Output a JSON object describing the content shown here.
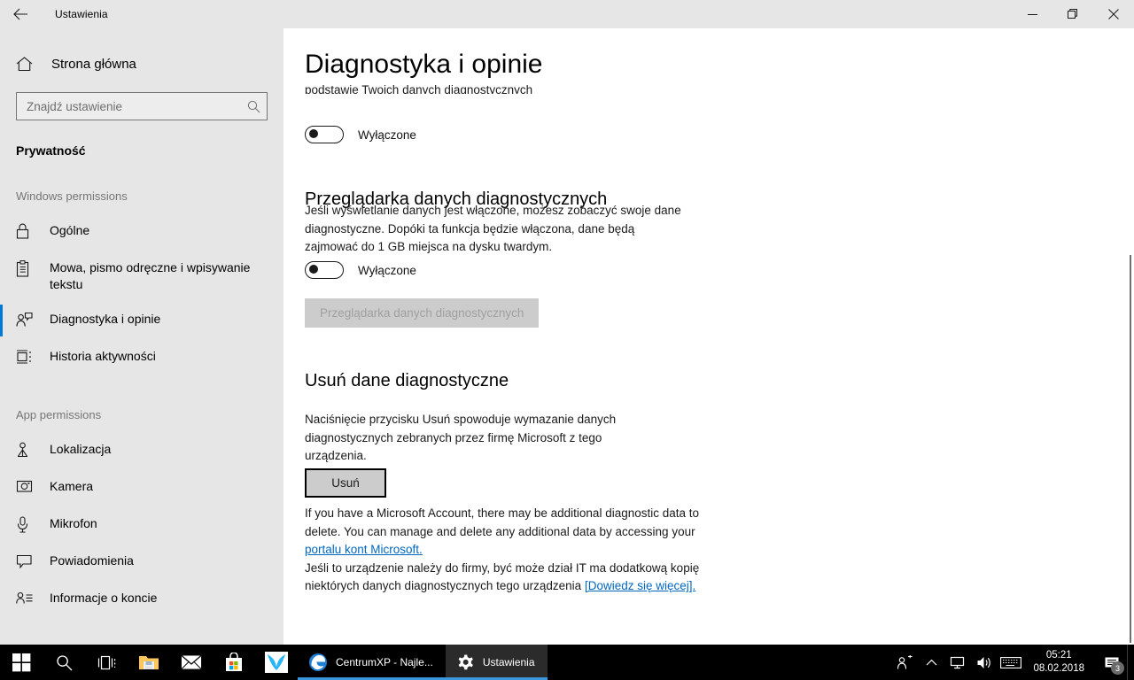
{
  "window": {
    "titlebar_title": "Ustawienia",
    "back_icon": "back-arrow-icon",
    "minimize_label": "minimize-icon",
    "restore_label": "restore-icon",
    "close_label": "close-icon"
  },
  "sidebar": {
    "home_label": "Strona główna",
    "home_icon": "home-icon",
    "search": {
      "placeholder": "Znajdź ustawienie",
      "value": "",
      "icon": "search-icon"
    },
    "category_title": "Prywatność",
    "groups": [
      {
        "header": "Windows permissions",
        "items": [
          {
            "label": "Ogólne",
            "icon": "lock-icon",
            "selected": false
          },
          {
            "label": "Mowa, pismo odręczne i wpisywanie tekstu",
            "icon": "clipboard-icon",
            "selected": false
          },
          {
            "label": "Diagnostyka i opinie",
            "icon": "feedback-person-icon",
            "selected": true
          },
          {
            "label": "Historia aktywności",
            "icon": "activity-history-icon",
            "selected": false
          }
        ]
      },
      {
        "header": "App permissions",
        "items": [
          {
            "label": "Lokalizacja",
            "icon": "location-pin-icon",
            "selected": false
          },
          {
            "label": "Kamera",
            "icon": "camera-icon",
            "selected": false
          },
          {
            "label": "Mikrofon",
            "icon": "microphone-icon",
            "selected": false
          },
          {
            "label": "Powiadomienia",
            "icon": "notification-bubble-icon",
            "selected": false
          },
          {
            "label": "Informacje o koncie",
            "icon": "account-info-icon",
            "selected": false
          }
        ]
      }
    ]
  },
  "main": {
    "page_title": "Diagnostyka i opinie",
    "clipped_text": "podstawie Twoich danych diagnostycznych",
    "tailored_toggle": {
      "state_label": "Wyłączone",
      "on": false
    },
    "data_viewer": {
      "heading": "Przeglądarka danych diagnostycznych",
      "description": "Jeśli wyświetlanie danych jest włączone, możesz zobaczyć swoje dane diagnostyczne. Dopóki ta funkcja będzie włączona, dane będą zajmować do 1 GB miejsca na dysku twardym.",
      "toggle_label": "Wyłączone",
      "toggle_on": false,
      "button_label": "Przeglądarka danych diagnostycznych",
      "button_disabled": true
    },
    "delete_data": {
      "heading": "Usuń dane diagnostyczne",
      "description": "Naciśnięcie przycisku Usuń spowoduje wymazanie danych diagnostycznych zebranych przez firmę Microsoft z tego urządzenia.",
      "button_label": "Usuń",
      "note_en_part1": "If you have a Microsoft Account, there may be additional diagnostic data to delete. You can manage and delete any additional data by accessing your ",
      "note_link1": "portalu kont Microsoft.",
      "note_pl_part": "Jeśli to urządzenie należy do firmy, być może dział IT ma dodatkową kopię niektórych danych diagnostycznych tego urządzenia ",
      "note_link2": "[Dowiedz się więcej]."
    }
  },
  "taskbar": {
    "icons": [
      {
        "name": "start-icon",
        "title": "Start"
      },
      {
        "name": "search-icon",
        "title": "Search"
      },
      {
        "name": "task-view-icon",
        "title": "Task View"
      },
      {
        "name": "file-explorer-icon",
        "title": "File Explorer"
      },
      {
        "name": "mail-icon",
        "title": "Mail"
      },
      {
        "name": "store-icon",
        "title": "Microsoft Store"
      },
      {
        "name": "vivaldi-icon",
        "title": "Vivaldi"
      }
    ],
    "tasks": [
      {
        "label": "CentrumXP - Najle...",
        "icon": "edge-icon",
        "active": false
      },
      {
        "label": "Ustawienia",
        "icon": "gear-icon",
        "active": true
      }
    ],
    "tray_icons": [
      {
        "name": "people-icon"
      },
      {
        "name": "chevron-up-icon"
      },
      {
        "name": "network-monitor-icon"
      },
      {
        "name": "volume-icon"
      },
      {
        "name": "keyboard-icon"
      }
    ],
    "clock": {
      "time": "05:21",
      "date": "08.02.2018"
    },
    "notifications": {
      "icon": "action-center-icon",
      "count": "3"
    }
  },
  "colors": {
    "accent": "#0078d7",
    "link": "#0067c0",
    "sidebar_bg": "#e6e6e6",
    "taskbar_bg": "#000000",
    "task_underline": "#3a96dd"
  }
}
